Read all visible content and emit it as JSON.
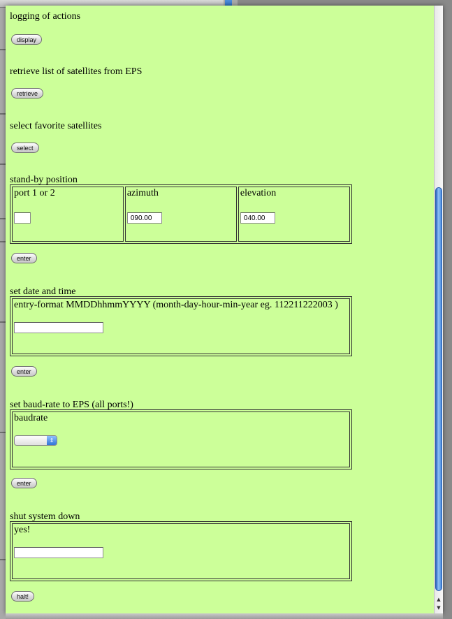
{
  "sections": {
    "logging": {
      "title": "logging of actions",
      "button": "display"
    },
    "retrieve": {
      "title": "retrieve list of satellites from EPS",
      "button": "retrieve"
    },
    "favorites": {
      "title": "select favorite satellites",
      "button": "select"
    },
    "standby": {
      "title": "stand-by position",
      "col_port": "port 1 or 2",
      "col_azimuth": "azimuth",
      "col_elevation": "elevation",
      "port_value": "",
      "azimuth_value": "090.00",
      "elevation_value": "040.00",
      "button": "enter"
    },
    "datetime": {
      "title": "set date and time",
      "hint": "entry-format MMDDhhmmYYYY (month-day-hour-min-year eg. 112211222003 )",
      "value": "",
      "button": "enter"
    },
    "baud": {
      "title": "set baud-rate to EPS (all ports!)",
      "label": "baudrate",
      "selected": "",
      "button": "enter"
    },
    "shutdown": {
      "title": "shut system down",
      "label": "yes!",
      "value": "",
      "button": "halt!"
    }
  },
  "scrollbar": {
    "up_icon": "scroll-up-arrow",
    "down_icon": "scroll-down-arrow"
  }
}
